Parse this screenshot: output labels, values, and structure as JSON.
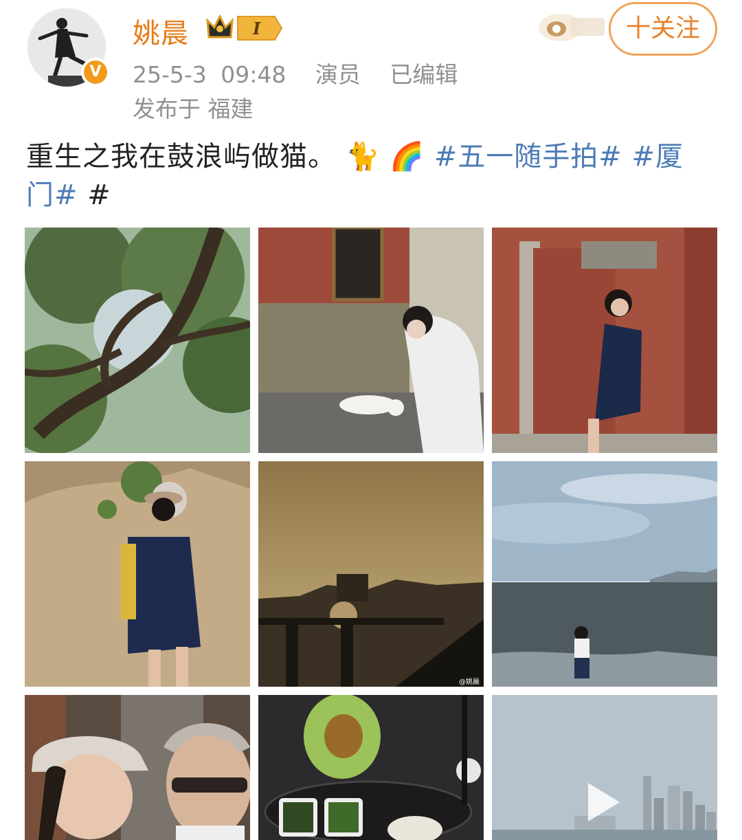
{
  "post": {
    "username": "姚晨",
    "vip_level": "I",
    "timestamp": "25-5-3 09:48",
    "role": "演员",
    "edited": "已编辑",
    "location": "发布于 福建",
    "follow_label": "十关注",
    "text_main": "重生之我在鼓浪屿做猫。",
    "emoji_cat": "🐈",
    "emoji_rainbow": "🌈",
    "tag1": "#五一随手拍#",
    "tag2_part1": "#厦",
    "tag2_part2": "门#",
    "tag3": "#"
  },
  "images": {
    "watermark": "@姚晨"
  },
  "colors": {
    "username": "#e77b17",
    "hashtag": "#4d7bb6",
    "follow_border": "#f0a25a",
    "meta_text": "#909090"
  },
  "icons": [
    "verified-icon",
    "crown-icon",
    "play-icon",
    "event-logo-icon"
  ]
}
